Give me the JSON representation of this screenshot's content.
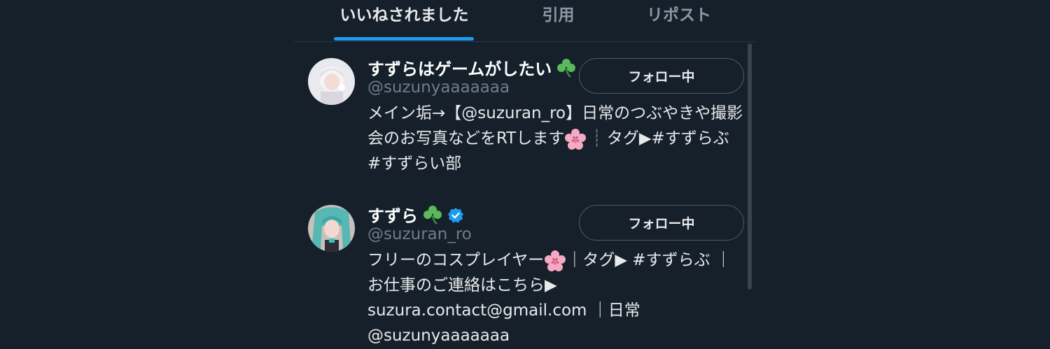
{
  "tabs": [
    {
      "label": "いいねされました",
      "active": true
    },
    {
      "label": "引用",
      "active": false
    },
    {
      "label": "リポスト",
      "active": false
    }
  ],
  "users": [
    {
      "name": "すずらはゲームがしたい",
      "name_icon": "shamrock-icon",
      "handle": "@suzunyaaaaaaa",
      "follow_label": "フォロー中",
      "bio_parts": {
        "a": "メイン垢→【@suzuran_ro】日常のつぶやきや撮影会のお写真などをRTします",
        "flower": "cherry-blossom-icon",
        "b": "タグ▶#すずらぶ #すずらい部"
      }
    },
    {
      "name": "すずら",
      "name_icon": "shamrock-icon",
      "verified": "verified-badge-icon",
      "handle": "@suzuran_ro",
      "follow_label": "フォロー中",
      "bio_parts": {
        "a": "フリーのコスプレイヤー",
        "flower": "cherry-blossom-icon",
        "b": "｜タグ▶ #すずらぶ ｜お仕事のご連絡はこちら▶ suzura.contact@gmail.com ｜日常 @suzunyaaaaaaa"
      }
    }
  ],
  "colors": {
    "background": "#16202b",
    "accent": "#1d9bf0",
    "muted": "#8b98a5"
  }
}
